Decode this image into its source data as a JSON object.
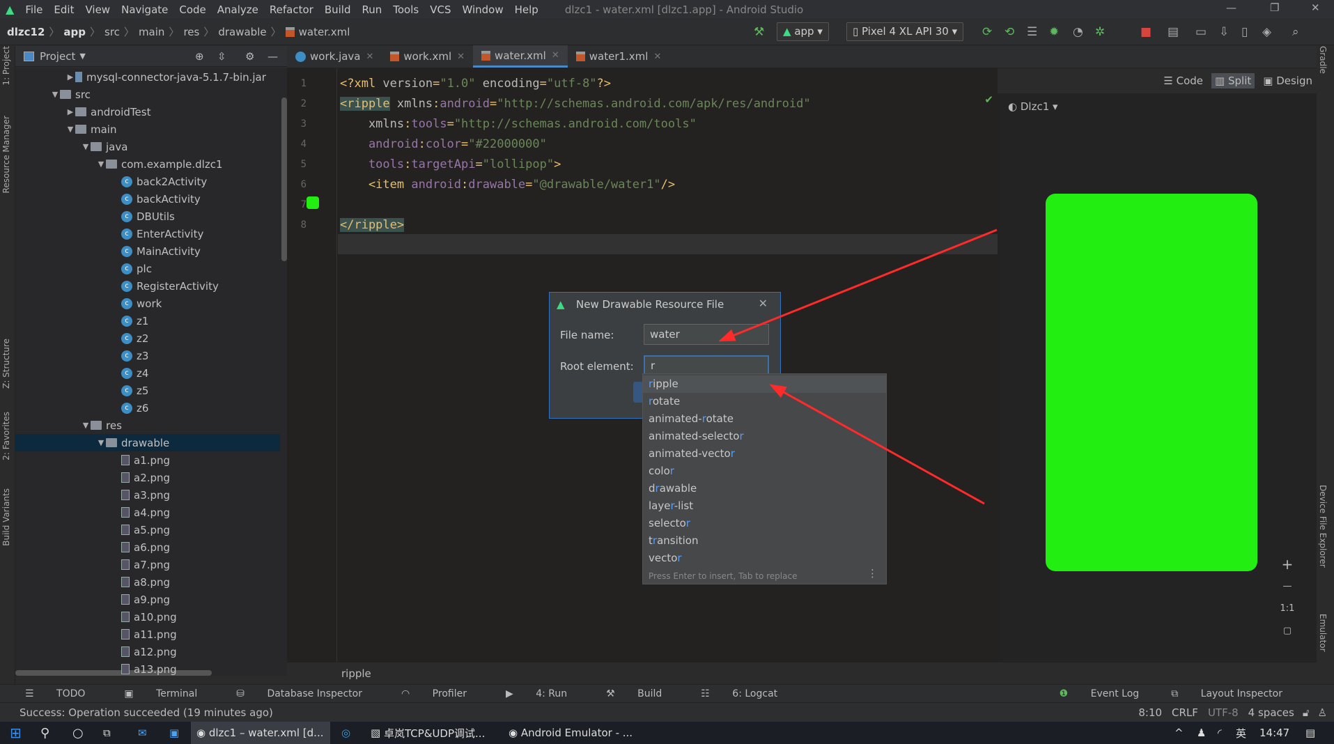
{
  "window": {
    "title": "dlzc1 - water.xml [dlzc1.app] - Android Studio",
    "minimize": "—",
    "maximize": "❐",
    "close": "✕"
  },
  "menu": [
    "File",
    "Edit",
    "View",
    "Navigate",
    "Code",
    "Analyze",
    "Refactor",
    "Build",
    "Run",
    "Tools",
    "VCS",
    "Window",
    "Help"
  ],
  "breadcrumb": [
    "dlzc12",
    "app",
    "src",
    "main",
    "res",
    "drawable",
    "water.xml"
  ],
  "toolbar": {
    "run_config": "app",
    "device": "Pixel 4 XL API 30"
  },
  "left_strip": [
    "1: Project",
    "Resource Manager",
    "Z: Structure",
    "2: Favorites",
    "Build Variants"
  ],
  "right_strip": [
    "Gradle",
    "Device File Explorer",
    "Emulator"
  ],
  "project_panel": {
    "title": "Project"
  },
  "tree": [
    {
      "label": "mysql-connector-java-5.1.7-bin.jar",
      "depth": 3,
      "icon": "jar",
      "arrow": "right"
    },
    {
      "label": "src",
      "depth": 2,
      "icon": "folder",
      "arrow": "down"
    },
    {
      "label": "androidTest",
      "depth": 3,
      "icon": "folder",
      "arrow": "right"
    },
    {
      "label": "main",
      "depth": 3,
      "icon": "folder",
      "arrow": "down"
    },
    {
      "label": "java",
      "depth": 4,
      "icon": "folder",
      "arrow": "down"
    },
    {
      "label": "com.example.dlzc1",
      "depth": 5,
      "icon": "folder",
      "arrow": "down"
    },
    {
      "label": "back2Activity",
      "depth": 6,
      "icon": "class"
    },
    {
      "label": "backActivity",
      "depth": 6,
      "icon": "class"
    },
    {
      "label": "DBUtils",
      "depth": 6,
      "icon": "class"
    },
    {
      "label": "EnterActivity",
      "depth": 6,
      "icon": "class"
    },
    {
      "label": "MainActivity",
      "depth": 6,
      "icon": "class"
    },
    {
      "label": "plc",
      "depth": 6,
      "icon": "class"
    },
    {
      "label": "RegisterActivity",
      "depth": 6,
      "icon": "class"
    },
    {
      "label": "work",
      "depth": 6,
      "icon": "class"
    },
    {
      "label": "z1",
      "depth": 6,
      "icon": "class"
    },
    {
      "label": "z2",
      "depth": 6,
      "icon": "class"
    },
    {
      "label": "z3",
      "depth": 6,
      "icon": "class"
    },
    {
      "label": "z4",
      "depth": 6,
      "icon": "class"
    },
    {
      "label": "z5",
      "depth": 6,
      "icon": "class"
    },
    {
      "label": "z6",
      "depth": 6,
      "icon": "class"
    },
    {
      "label": "res",
      "depth": 4,
      "icon": "folder",
      "arrow": "down"
    },
    {
      "label": "drawable",
      "depth": 5,
      "icon": "folder",
      "arrow": "down",
      "selected": true
    },
    {
      "label": "a1.png",
      "depth": 6,
      "icon": "png"
    },
    {
      "label": "a2.png",
      "depth": 6,
      "icon": "png"
    },
    {
      "label": "a3.png",
      "depth": 6,
      "icon": "png"
    },
    {
      "label": "a4.png",
      "depth": 6,
      "icon": "png"
    },
    {
      "label": "a5.png",
      "depth": 6,
      "icon": "png"
    },
    {
      "label": "a6.png",
      "depth": 6,
      "icon": "png"
    },
    {
      "label": "a7.png",
      "depth": 6,
      "icon": "png"
    },
    {
      "label": "a8.png",
      "depth": 6,
      "icon": "png"
    },
    {
      "label": "a9.png",
      "depth": 6,
      "icon": "png"
    },
    {
      "label": "a10.png",
      "depth": 6,
      "icon": "png"
    },
    {
      "label": "a11.png",
      "depth": 6,
      "icon": "png"
    },
    {
      "label": "a12.png",
      "depth": 6,
      "icon": "png"
    },
    {
      "label": "a13.png",
      "depth": 6,
      "icon": "png"
    }
  ],
  "tabs": [
    {
      "label": "work.java",
      "type": "java"
    },
    {
      "label": "work.xml",
      "type": "xml"
    },
    {
      "label": "water.xml",
      "type": "xml",
      "active": true
    },
    {
      "label": "water1.xml",
      "type": "xml"
    }
  ],
  "editor": {
    "line_numbers": [
      "1",
      "2",
      "3",
      "4",
      "5",
      "6",
      "7",
      "8"
    ],
    "lines": [
      [
        [
          "tg",
          "<?xml "
        ],
        [
          "at",
          "version"
        ],
        [
          "tg",
          "="
        ],
        [
          "st",
          "\"1.0\""
        ],
        [
          "at",
          " encoding"
        ],
        [
          "tg",
          "="
        ],
        [
          "st",
          "\"utf-8\""
        ],
        [
          "tg",
          "?>"
        ]
      ],
      [
        [
          "tg tgbg",
          "<ripple"
        ],
        [
          "at",
          " xmlns"
        ],
        [
          "tg",
          ":"
        ],
        [
          "ns",
          "android"
        ],
        [
          "tg",
          "="
        ],
        [
          "st",
          "\"http://schemas.android.com/apk/res/android\""
        ]
      ],
      [
        [
          "at",
          "    xmlns"
        ],
        [
          "tg",
          ":"
        ],
        [
          "ns",
          "tools"
        ],
        [
          "tg",
          "="
        ],
        [
          "st",
          "\"http://schemas.android.com/tools\""
        ]
      ],
      [
        [
          "ns",
          "    android"
        ],
        [
          "tg",
          ":"
        ],
        [
          "ac",
          "color"
        ],
        [
          "tg",
          "="
        ],
        [
          "st",
          "\"#22000000\""
        ]
      ],
      [
        [
          "ns",
          "    tools"
        ],
        [
          "tg",
          ":"
        ],
        [
          "ac",
          "targetApi"
        ],
        [
          "tg",
          "="
        ],
        [
          "st",
          "\"lollipop\""
        ],
        [
          "tg",
          ">"
        ]
      ],
      [
        [
          "tg",
          "    <item "
        ],
        [
          "ns",
          "android"
        ],
        [
          "tg",
          ":"
        ],
        [
          "ac",
          "drawable"
        ],
        [
          "tg",
          "="
        ],
        [
          "st",
          "\"@drawable/water1\""
        ],
        [
          "tg",
          "/>"
        ]
      ],
      [],
      [
        [
          "tg tgbg",
          "</ripple>"
        ]
      ]
    ],
    "status_breadcrumb": "ripple"
  },
  "view_modes": [
    "Code",
    "Split",
    "Design"
  ],
  "preview": {
    "theme": "Dlzc1",
    "drawable_color": "#22ee11",
    "zoom_controls": [
      "+",
      "—",
      "1:1"
    ]
  },
  "dialog": {
    "title": "New Drawable Resource File",
    "file_name_label": "File name:",
    "file_name_value": "water",
    "root_element_label": "Root element:",
    "root_element_value": "r"
  },
  "autocomplete": {
    "items": [
      "ripple",
      "rotate",
      "animated-rotate",
      "animated-selector",
      "animated-vector",
      "color",
      "drawable",
      "layer-list",
      "selector",
      "transition",
      "vector"
    ],
    "hint": "Press Enter to insert, Tab to replace"
  },
  "bottom_tools": [
    "TODO",
    "Terminal",
    "Database Inspector",
    "Profiler",
    "4: Run",
    "Build",
    "6: Logcat"
  ],
  "bottom_tools_right": [
    "Event Log",
    "Layout Inspector"
  ],
  "status": {
    "message": "Success: Operation succeeded (19 minutes ago)",
    "position": "8:10",
    "line_sep": "CRLF",
    "encoding": "UTF-8",
    "indent": "4 spaces"
  },
  "taskbar": {
    "apps": [
      "dlzc1 – water.xml [d...",
      "卓岚TCP&UDP调试...",
      "Android Emulator - ..."
    ],
    "ime": "英",
    "time": "14:47"
  },
  "colors": {
    "accent": "#4a88c7",
    "annotation_arrow": "#ff2a2a",
    "android_green": "#3ddc84"
  }
}
